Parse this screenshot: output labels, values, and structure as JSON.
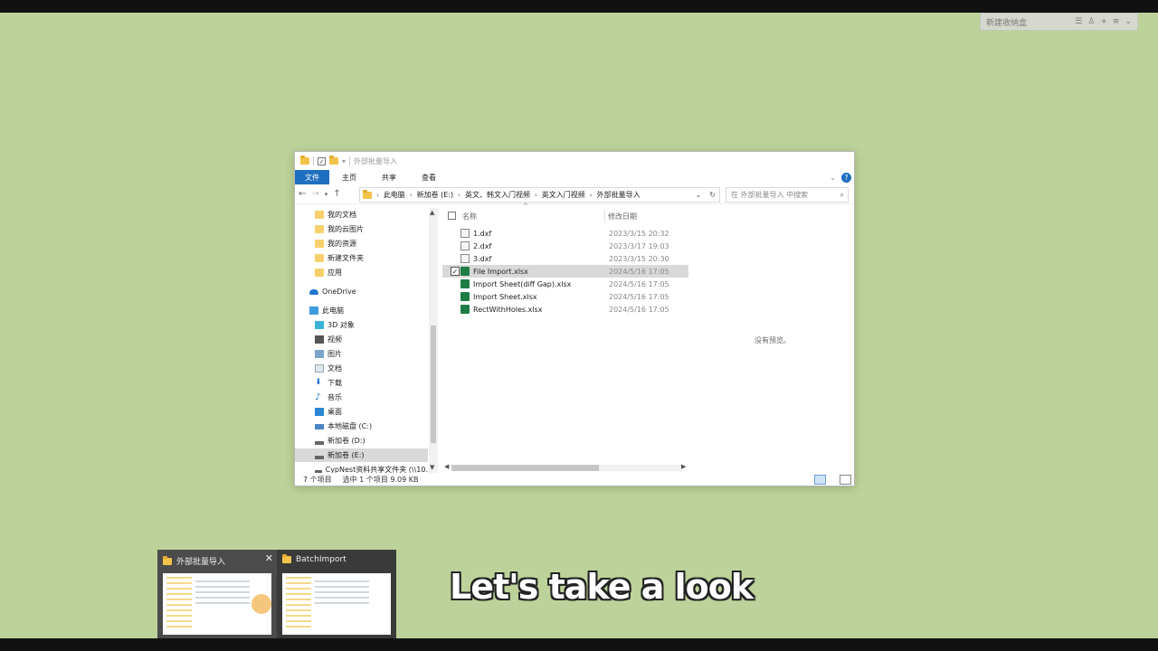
{
  "corner_widget": {
    "label": "新建收纳盒",
    "icons": [
      "list-icon",
      "user-icon",
      "plus-icon",
      "menu-icon",
      "chevron-down-icon"
    ]
  },
  "explorer": {
    "title": "外部批量导入",
    "ribbon": {
      "file_tab": "文件",
      "tabs": [
        "主页",
        "共享",
        "查看"
      ]
    },
    "address": {
      "segments": [
        "此电脑",
        "新加卷 (E:)",
        "英文、韩文入门视频",
        "英文入门视频",
        "外部批量导入"
      ]
    },
    "search": {
      "placeholder": "在 外部批量导入 中搜索"
    },
    "nav_items": [
      {
        "label": "我的文档",
        "icon": "folder-icon"
      },
      {
        "label": "我的云图片",
        "icon": "folder-icon"
      },
      {
        "label": "我的资源",
        "icon": "folder-icon"
      },
      {
        "label": "新建文件夹",
        "icon": "folder-icon"
      },
      {
        "label": "应用",
        "icon": "folder-icon"
      },
      {
        "label": "OneDrive",
        "icon": "cloud-icon"
      },
      {
        "label": "此电脑",
        "icon": "computer-icon"
      },
      {
        "label": "3D 对象",
        "icon": "cube-icon"
      },
      {
        "label": "视频",
        "icon": "video-icon"
      },
      {
        "label": "图片",
        "icon": "picture-icon"
      },
      {
        "label": "文档",
        "icon": "document-icon"
      },
      {
        "label": "下载",
        "icon": "download-icon"
      },
      {
        "label": "音乐",
        "icon": "music-icon"
      },
      {
        "label": "桌面",
        "icon": "desktop-icon"
      },
      {
        "label": "本地磁盘 (C:)",
        "icon": "drive-icon"
      },
      {
        "label": "新加卷 (D:)",
        "icon": "drive-icon"
      },
      {
        "label": "新加卷 (E:)",
        "icon": "drive-icon"
      },
      {
        "label": "CypNest资料共享文件夹 (\\\\10.",
        "icon": "network-drive-icon"
      }
    ],
    "columns": {
      "name": "名称",
      "date": "修改日期"
    },
    "files": [
      {
        "name": "1.dxf",
        "date": "2023/3/15 20:32",
        "type": "dxf"
      },
      {
        "name": "2.dxf",
        "date": "2023/3/17 19:03",
        "type": "dxf"
      },
      {
        "name": "3.dxf",
        "date": "2023/3/15 20:30",
        "type": "dxf"
      },
      {
        "name": "File Import.xlsx",
        "date": "2024/5/16 17:05",
        "type": "xlsx"
      },
      {
        "name": "Import Sheet(diff Gap).xlsx",
        "date": "2024/5/16 17:05",
        "type": "xlsx"
      },
      {
        "name": "Import Sheet.xlsx",
        "date": "2024/5/16 17:05",
        "type": "xlsx"
      },
      {
        "name": "RectWithHoles.xlsx",
        "date": "2024/5/16 17:05",
        "type": "xlsx"
      }
    ],
    "preview_text": "没有预览。",
    "status": {
      "count": "7 个项目",
      "selected": "选中 1 个项目  9.09 KB"
    }
  },
  "taskbar_thumbs": [
    {
      "title": "外部批量导入"
    },
    {
      "title": "BatchImport"
    }
  ],
  "caption": "Let's take a look"
}
